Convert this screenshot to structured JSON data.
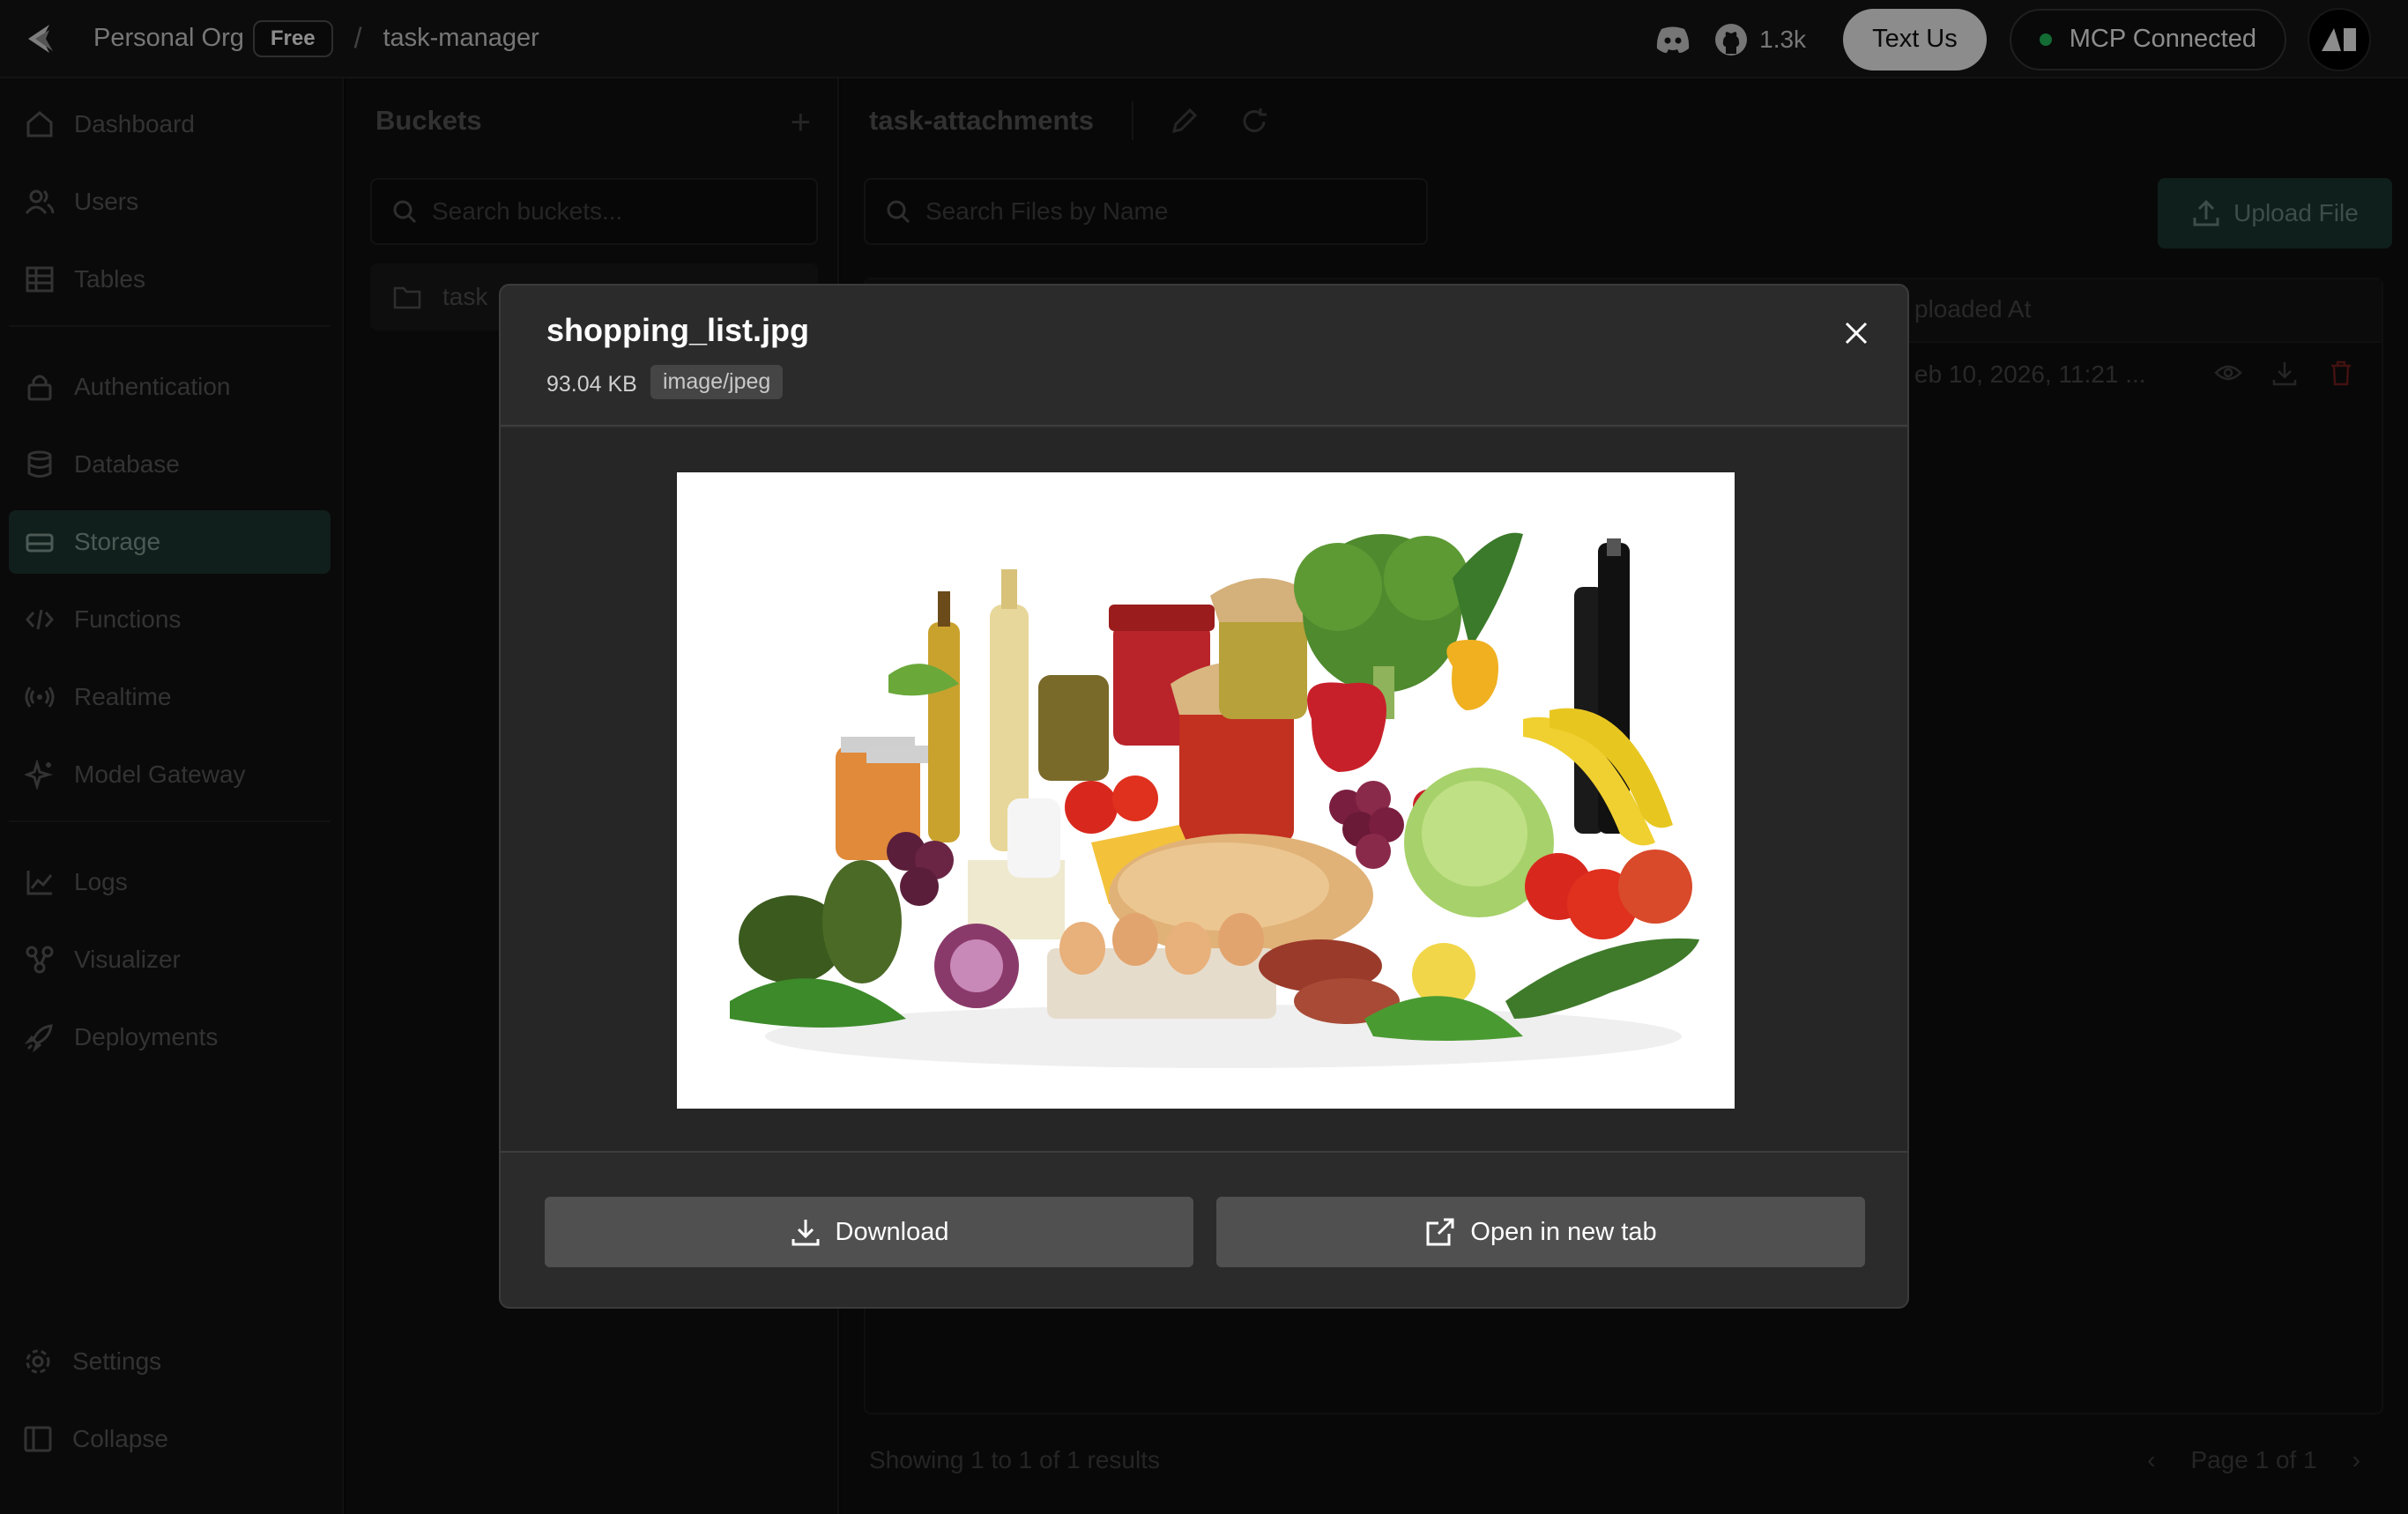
{
  "topbar": {
    "org": "Personal Org",
    "plan": "Free",
    "separator": "/",
    "project": "task-manager",
    "github_stars": "1.3k",
    "text_us": "Text Us",
    "mcp": "MCP Connected"
  },
  "sidebar": {
    "items": [
      {
        "label": "Dashboard"
      },
      {
        "label": "Users"
      },
      {
        "label": "Tables"
      },
      {
        "label": "Authentication"
      },
      {
        "label": "Database"
      },
      {
        "label": "Storage"
      },
      {
        "label": "Functions"
      },
      {
        "label": "Realtime"
      },
      {
        "label": "Model Gateway"
      },
      {
        "label": "Logs"
      },
      {
        "label": "Visualizer"
      },
      {
        "label": "Deployments"
      }
    ],
    "settings": "Settings",
    "collapse": "Collapse"
  },
  "buckets": {
    "title": "Buckets",
    "search_placeholder": "Search buckets...",
    "item": "task"
  },
  "main": {
    "bucket_title": "task-attachments",
    "search_placeholder": "Search Files by Name",
    "upload": "Upload File",
    "col_uploaded": "ploaded At",
    "row_date": "eb 10, 2026, 11:21 ...",
    "footer_left": "Showing 1 to 1 of 1 results",
    "page": "Page 1 of 1"
  },
  "modal": {
    "filename": "shopping_list.jpg",
    "size": "93.04 KB",
    "type": "image/jpeg",
    "download": "Download",
    "open_tab": "Open in new tab"
  },
  "colors": {
    "accent": "#1f3a33",
    "status_green": "#22c55e",
    "delete_red": "#7a1f1f"
  }
}
